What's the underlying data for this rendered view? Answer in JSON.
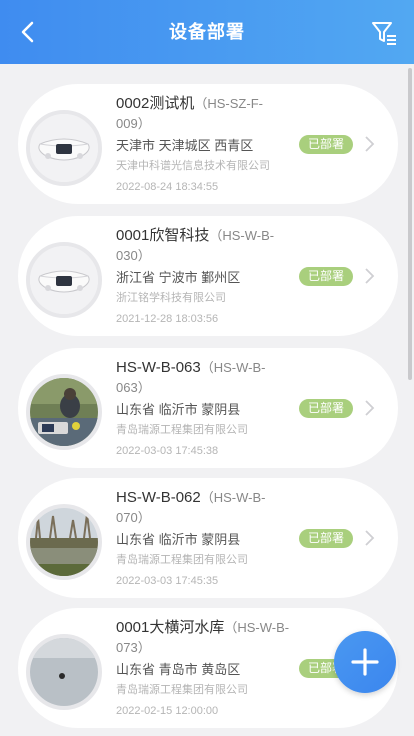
{
  "header": {
    "title": "设备部署"
  },
  "devices": [
    {
      "name": "0002测试机",
      "code": "（HS-SZ-F-009）",
      "region": "天津市 天津城区 西青区",
      "company": "天津中科谱光信息技术有限公司",
      "time": "2022-08-24 18:34:55",
      "status": "已部署"
    },
    {
      "name": "0001欣智科技",
      "code": "（HS-W-B-030）",
      "region": "浙江省 宁波市 鄞州区",
      "company": "浙江铭学科技有限公司",
      "time": "2021-12-28 18:03:56",
      "status": "已部署"
    },
    {
      "name": "HS-W-B-063",
      "code": "（HS-W-B-063）",
      "region": "山东省 临沂市 蒙阴县",
      "company": "青岛瑞源工程集团有限公司",
      "time": "2022-03-03 17:45:38",
      "status": "已部署"
    },
    {
      "name": "HS-W-B-062",
      "code": "（HS-W-B-070）",
      "region": "山东省 临沂市 蒙阴县",
      "company": "青岛瑞源工程集团有限公司",
      "time": "2022-03-03 17:45:35",
      "status": "已部署"
    },
    {
      "name": "0001大横河水库",
      "code": "（HS-W-B-073）",
      "region": "山东省 青岛市 黄岛区",
      "company": "青岛瑞源工程集团有限公司",
      "time": "2022-02-15 12:00:00",
      "status": "已部署"
    }
  ],
  "icons": {
    "back": "chevron-left-icon",
    "filter": "filter-icon",
    "row": "chevron-right-icon",
    "add": "plus-icon"
  },
  "colors": {
    "header": "#4595f1",
    "badge": "#a9cf7d",
    "fab": "#3f8cf0"
  }
}
